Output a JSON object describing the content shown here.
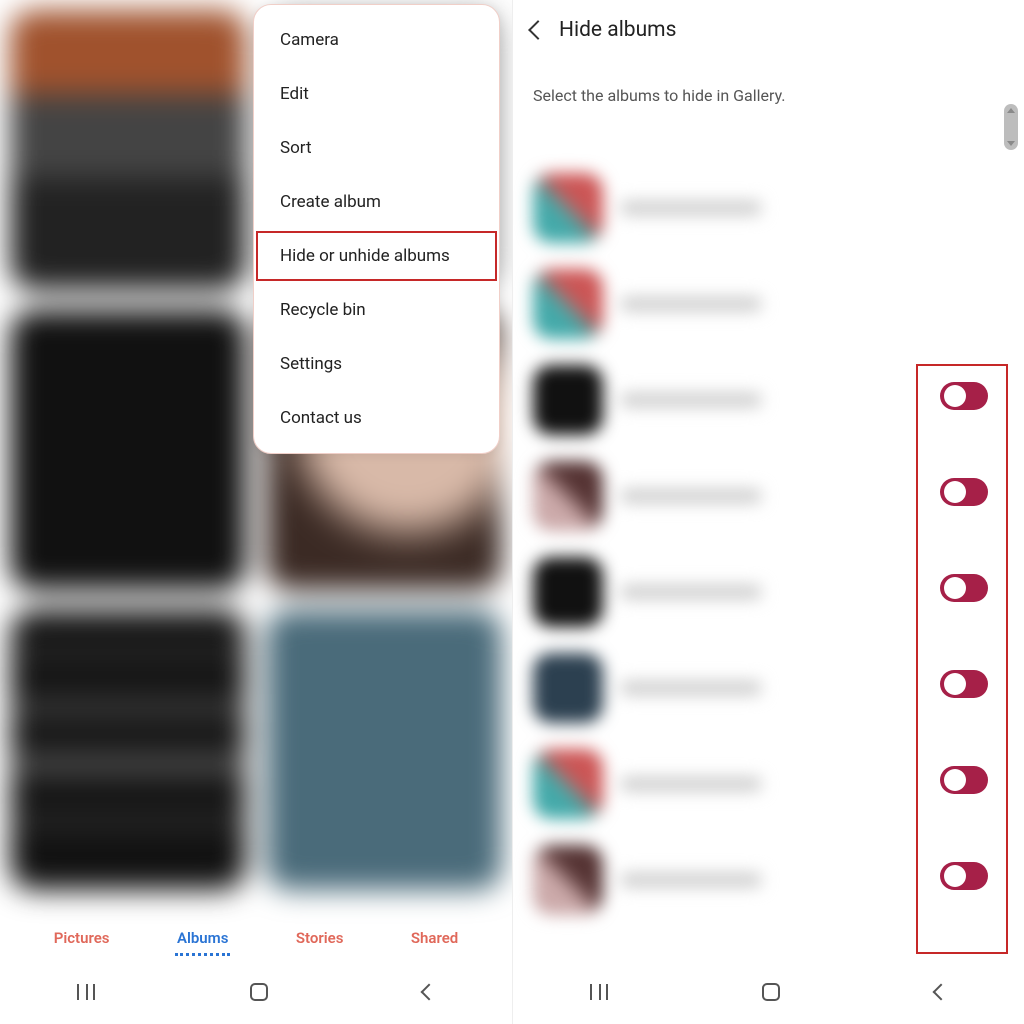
{
  "left": {
    "menu": {
      "items": [
        {
          "label": "Camera"
        },
        {
          "label": "Edit"
        },
        {
          "label": "Sort"
        },
        {
          "label": "Create album"
        },
        {
          "label": "Hide or unhide albums"
        },
        {
          "label": "Recycle bin"
        },
        {
          "label": "Settings"
        },
        {
          "label": "Contact us"
        }
      ]
    },
    "tabs": {
      "pictures": "Pictures",
      "albums": "Albums",
      "stories": "Stories",
      "shared": "Shared"
    }
  },
  "right": {
    "title": "Hide albums",
    "description": "Select the albums to hide in Gallery."
  }
}
